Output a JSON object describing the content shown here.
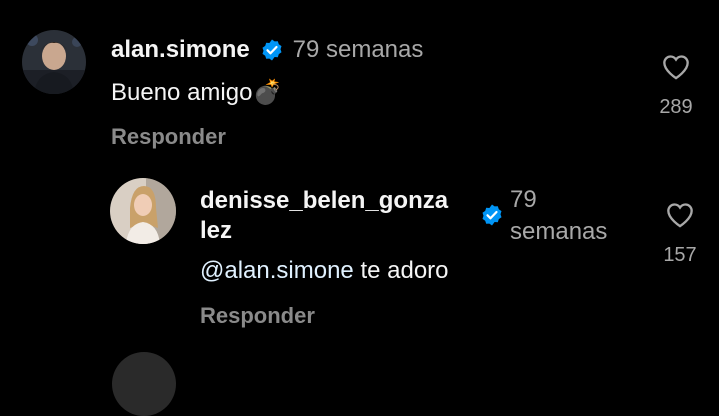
{
  "comments": [
    {
      "username": "alan.simone",
      "time": "79 semanas",
      "text": "Bueno amigo",
      "emoji": "💣",
      "reply_label": "Responder",
      "likes": "289",
      "verified": true
    },
    {
      "username_line1": "denisse_belen_gonza",
      "username_line2": "lez",
      "time_line1": "79",
      "time_line2": "semanas",
      "mention": "@alan.simone",
      "text": " te adoro",
      "reply_label": "Responder",
      "likes": "157",
      "verified": true
    }
  ],
  "colors": {
    "background": "#000000",
    "verified_badge": "#0095f6",
    "muted_text": "#a8a8a8"
  }
}
